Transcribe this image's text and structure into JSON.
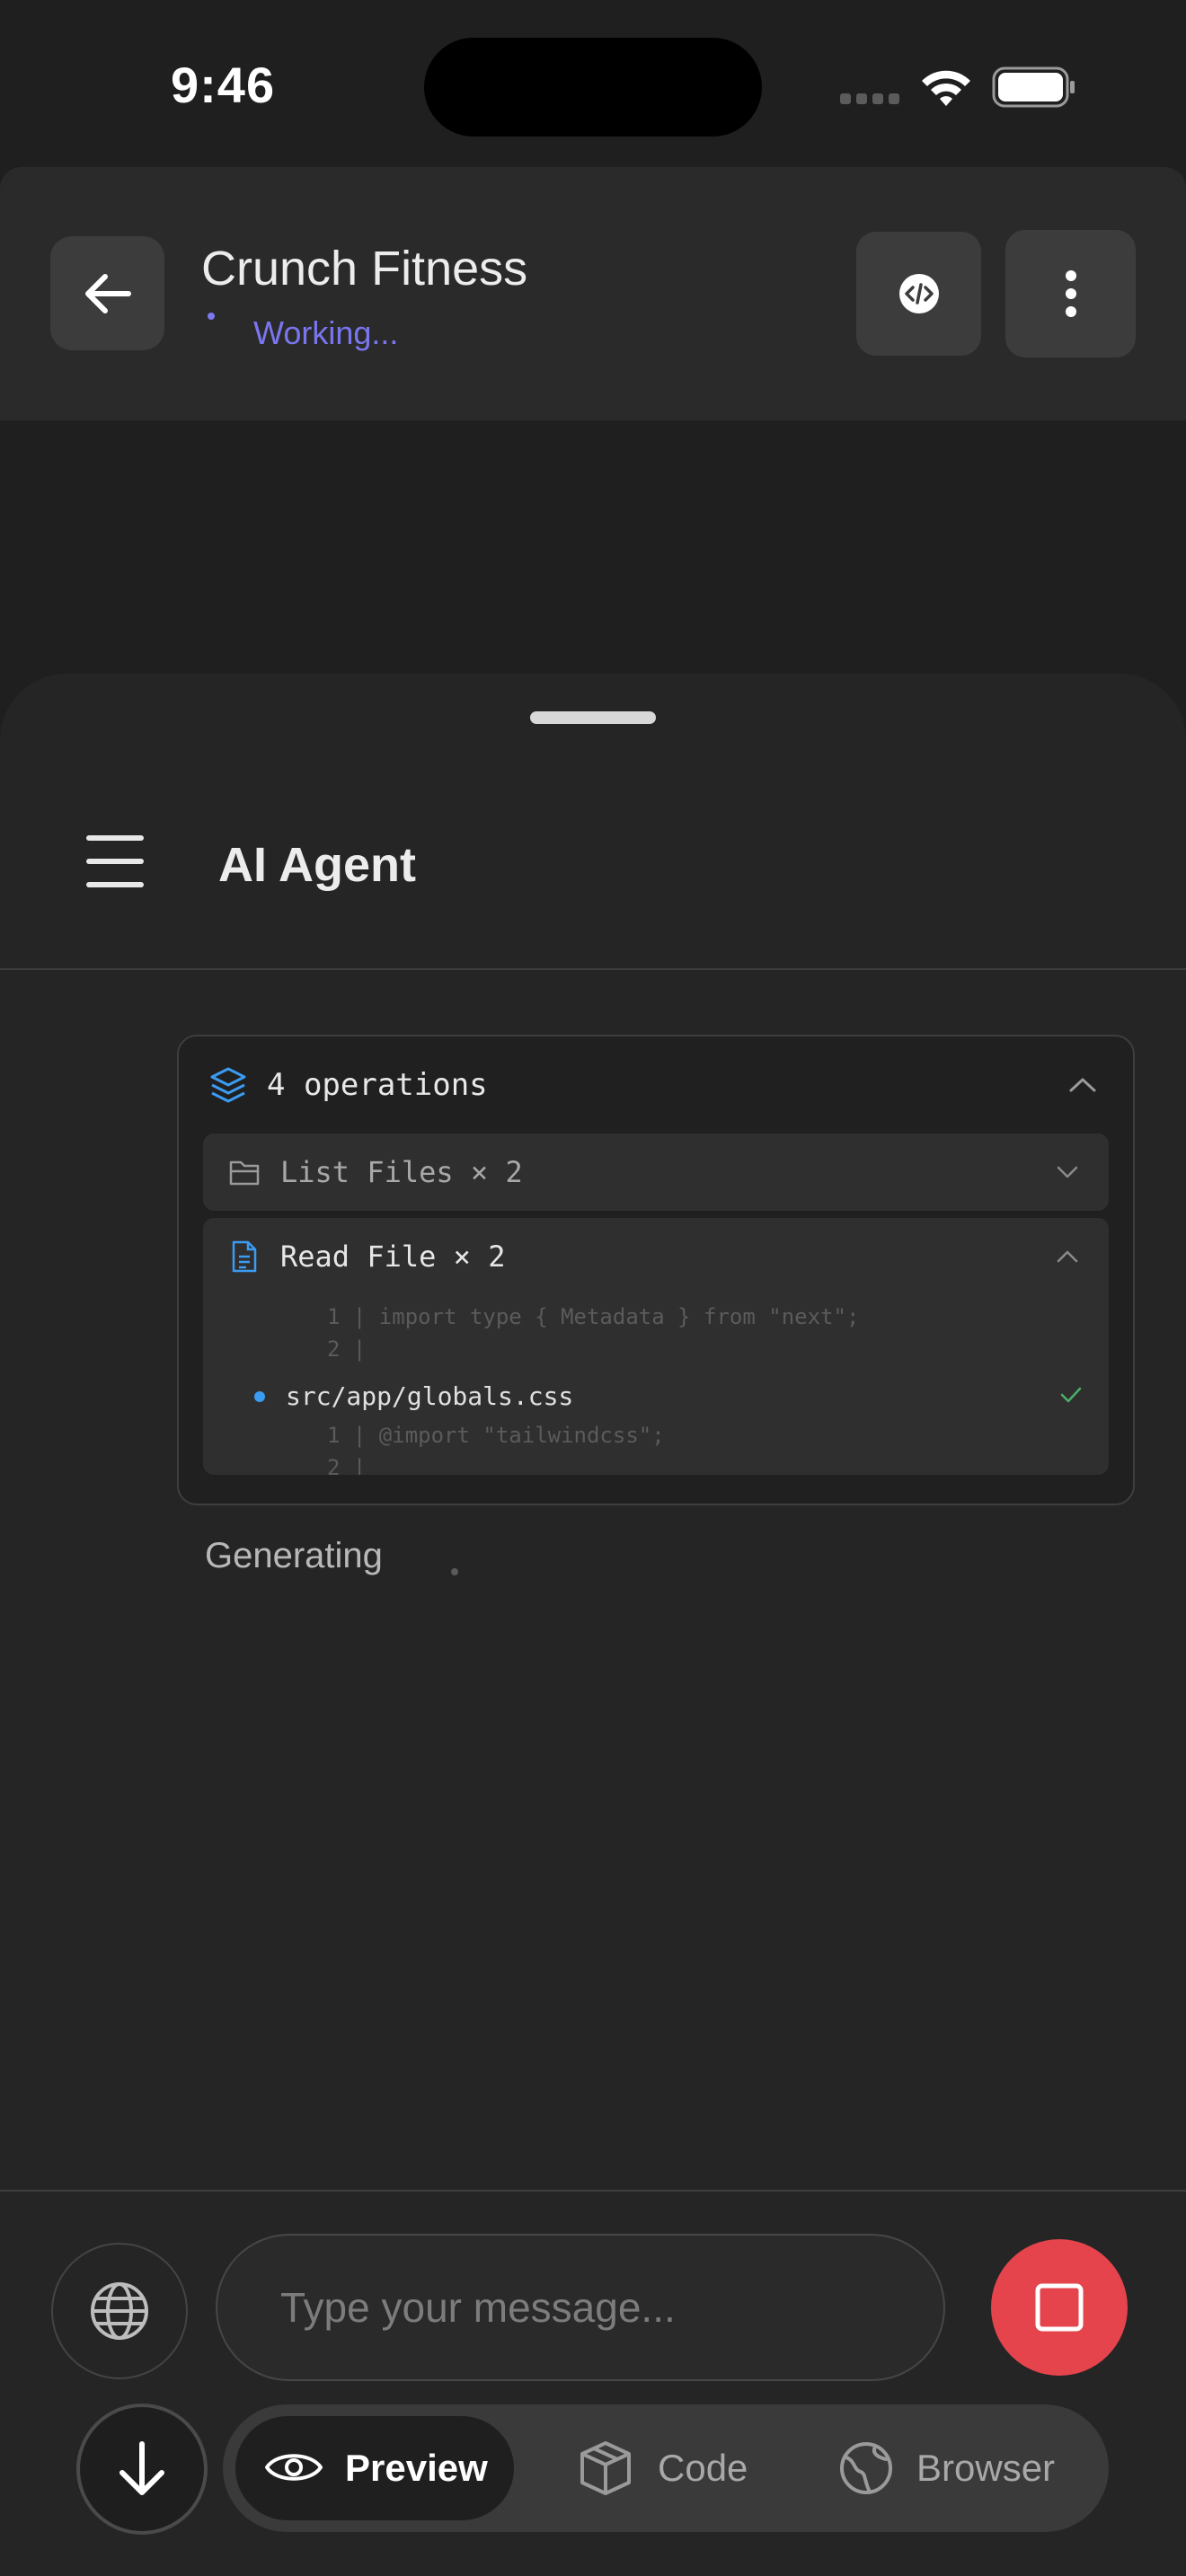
{
  "status_bar": {
    "time": "9:46"
  },
  "header": {
    "title": "Crunch Fitness",
    "status": "Working...",
    "status_color": "#7a76f0"
  },
  "agent_panel": {
    "title": "AI Agent",
    "operations": {
      "summary": "4 operations",
      "groups": [
        {
          "label": "List Files × 2",
          "icon": "folder-icon",
          "expanded": false
        },
        {
          "label": "Read File × 2",
          "icon": "file-icon",
          "expanded": true,
          "snippet_1": [
            "1 | import type { Metadata } from \"next\";",
            "2 |"
          ],
          "file": "src/app/globals.css",
          "snippet_2": [
            "1 | @import \"tailwindcss\";",
            "2 |"
          ]
        }
      ]
    },
    "generating_label": "Generating"
  },
  "composer": {
    "placeholder": "Type your message..."
  },
  "tabs": [
    {
      "label": "Preview",
      "icon": "eye-icon",
      "active": true
    },
    {
      "label": "Code",
      "icon": "box-icon",
      "active": false
    },
    {
      "label": "Browser",
      "icon": "globe-icon",
      "active": false
    }
  ],
  "colors": {
    "accent": "#7a76f0",
    "stop_button": "#e5444d",
    "info_blue": "#3b9cf3",
    "success_green": "#4caf68"
  }
}
